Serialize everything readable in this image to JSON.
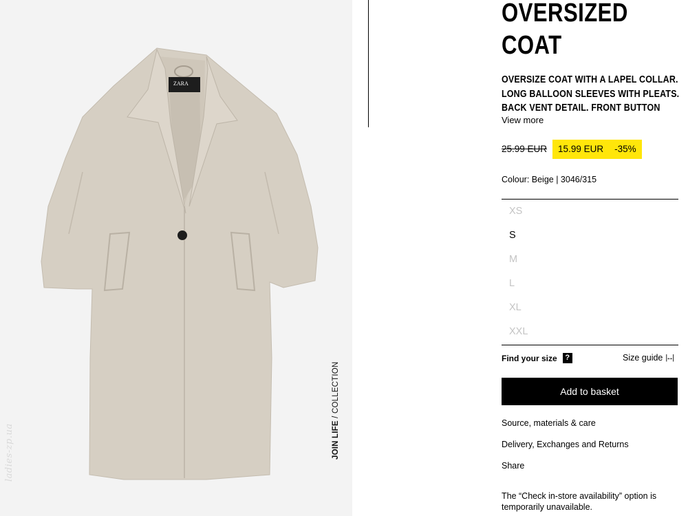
{
  "image": {
    "collection_bold": "JOIN LIFE",
    "collection_rest": " / COLLECTION",
    "label_brand": "ZARA",
    "watermark": "ladies-zp.ua",
    "coat_color": "#d6cfc3"
  },
  "product": {
    "title_line1": "OVERSIZED",
    "title_line2": "COAT",
    "desc_line1": "OVERSIZE COAT WITH A LAPEL COLLAR.",
    "desc_line2": "LONG BALLOON SLEEVES WITH PLEATS.",
    "desc_line3": "BACK VENT DETAIL. FRONT BUTTON",
    "view_more": "View more",
    "old_price": "25.99 EUR",
    "sale_price": "15.99 EUR",
    "discount": "-35%",
    "colour": "Colour: Beige | 3046/315",
    "sale_color": "#ffe60a"
  },
  "sizes": [
    {
      "label": "XS",
      "available": false
    },
    {
      "label": "S",
      "available": true
    },
    {
      "label": "M",
      "available": false
    },
    {
      "label": "L",
      "available": false
    },
    {
      "label": "XL",
      "available": false
    },
    {
      "label": "XXL",
      "available": false
    }
  ],
  "actions": {
    "find_size": "Find your size",
    "help_icon": "?",
    "size_guide": "Size guide",
    "size_guide_icon": "|↔|",
    "add_to_basket": "Add to basket"
  },
  "links": {
    "materials": "Source, materials & care",
    "delivery": "Delivery, Exchanges and Returns",
    "share": "Share"
  },
  "notice": "The “Check in-store availability” option is temporarily unavailable."
}
